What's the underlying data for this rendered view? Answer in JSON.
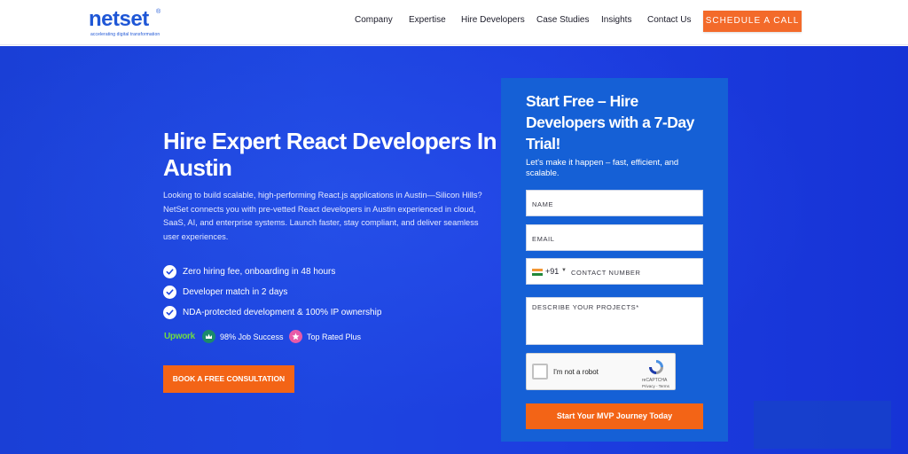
{
  "header": {
    "logo_text": "netset",
    "logo_reg": "®",
    "logo_tagline": "accelerating digital transformation",
    "nav": [
      "Company",
      "Expertise",
      "Hire Developers",
      "Case Studies",
      "Insights",
      "Contact Us"
    ],
    "cta_label": "SCHEDULE A CALL"
  },
  "hero": {
    "title": "Hire Expert React Developers In Austin",
    "description": "Looking to build scalable, high-performing React.js applications in Austin—Silicon Hills? NetSet connects you with pre-vetted React developers in Austin experienced in cloud, SaaS, AI, and enterprise systems. Launch faster, stay compliant, and deliver seamless user experiences.",
    "benefits": [
      "Zero hiring fee, onboarding in 48 hours",
      "Developer match in 2 days",
      "NDA-protected development & 100% IP ownership"
    ],
    "badges": {
      "upwork": "Upwork",
      "job_success": "98% Job Success",
      "top_rated": "Top Rated Plus"
    },
    "consult_label": "BOOK A FREE CONSULTATION"
  },
  "form": {
    "title": "Start Free – Hire Developers with a 7-Day Trial!",
    "subtitle": "Let's make it happen – fast, efficient, and scalable.",
    "name_placeholder": "NAME",
    "email_placeholder": "EMAIL",
    "phone_code": "+91",
    "phone_placeholder": "CONTACT NUMBER",
    "projects_placeholder": "DESCRIBE YOUR PROJECTS*",
    "captcha_label": "I'm not a robot",
    "captcha_brand": "reCAPTCHA",
    "captcha_links": "Privacy - Terms",
    "submit_label": "Start Your MVP Journey Today"
  },
  "colors": {
    "brand_blue": "#1f57d6",
    "cta_orange": "#f36416",
    "card_blue": "#1560d6"
  }
}
